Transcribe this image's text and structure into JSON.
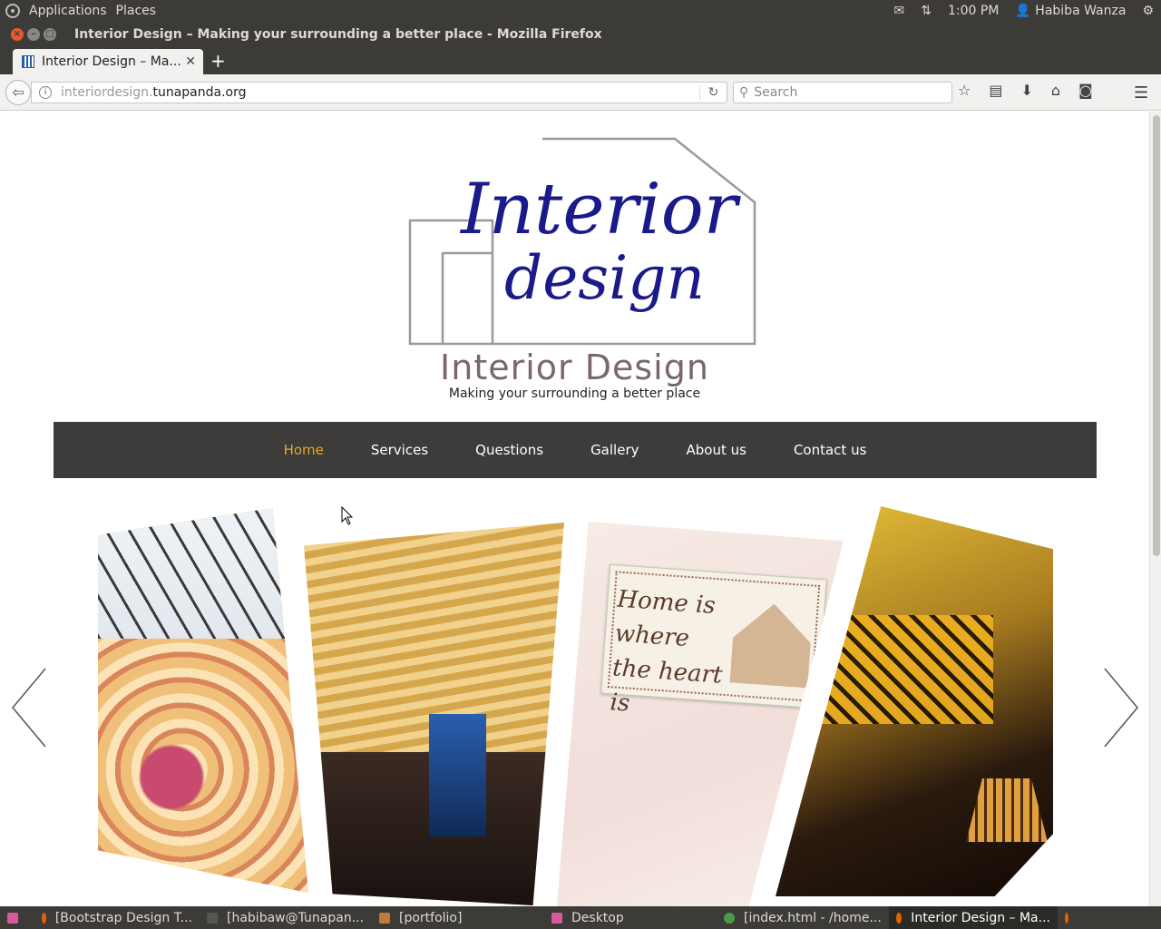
{
  "panel": {
    "applications": "Applications",
    "places": "Places",
    "time": "1:00 PM",
    "user": "Habiba Wanza"
  },
  "window": {
    "title": "Interior Design – Making your surrounding a better place - Mozilla Firefox"
  },
  "browser": {
    "tab_title": "Interior Design – Ma...",
    "url_host": "interiordesign.",
    "url_domain": "tunapanda.org",
    "search_placeholder": "Search"
  },
  "site": {
    "logo_line1": "Interior",
    "logo_line2": "design",
    "title": "Interior Design",
    "tagline": "Making your surrounding a better place",
    "nav": [
      {
        "label": "Home",
        "active": true
      },
      {
        "label": "Services"
      },
      {
        "label": "Questions"
      },
      {
        "label": "Gallery"
      },
      {
        "label": "About us"
      },
      {
        "label": "Contact us"
      }
    ],
    "slide_sign_text": "Home is where the heart is"
  },
  "taskbar": [
    {
      "label": "[Bootstrap Design T...",
      "icon": "firefox-icon"
    },
    {
      "label": "[habibaw@Tunapan...",
      "icon": "terminal-icon"
    },
    {
      "label": "[portfolio]",
      "icon": "folder-icon"
    },
    {
      "label": "Desktop",
      "icon": "desktop-icon"
    },
    {
      "label": "[index.html - /home...",
      "icon": "editor-icon"
    },
    {
      "label": "Interior Design – Ma...",
      "icon": "firefox-icon",
      "active": true
    }
  ],
  "colors": {
    "nav_active": "#e2a92c",
    "nav_bg": "#3d3c3a",
    "logo_blue": "#1b1a8a"
  }
}
